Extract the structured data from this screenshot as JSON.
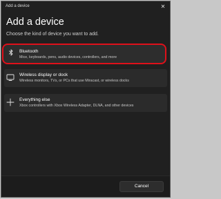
{
  "window": {
    "title": "Add a device",
    "close_glyph": "✕"
  },
  "main": {
    "heading": "Add a device",
    "subheading": "Choose the kind of device you want to add."
  },
  "options": [
    {
      "icon": "bluetooth-icon",
      "title": "Bluetooth",
      "description": "Mice, keyboards, pens, audio devices, controllers, and more",
      "highlighted": true,
      "highlight_color": "#e0101a"
    },
    {
      "icon": "monitor-icon",
      "title": "Wireless display or dock",
      "description": "Wireless monitors, TVs, or PCs that use Miracast, or wireless docks"
    },
    {
      "icon": "plus-icon",
      "title": "Everything else",
      "description": "Xbox controllers with Xbox Wireless Adapter, DLNA, and other devices"
    }
  ],
  "footer": {
    "cancel_label": "Cancel"
  }
}
